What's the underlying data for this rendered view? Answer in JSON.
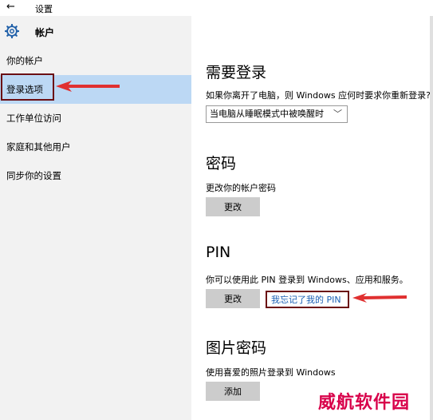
{
  "titlebar": {
    "back_glyph": "←",
    "title": "设置"
  },
  "sidebar": {
    "section_title": "帐户",
    "section_icon": "gear-icon",
    "items": [
      {
        "label": "你的帐户"
      },
      {
        "label": "登录选项",
        "selected": true
      },
      {
        "label": "工作单位访问"
      },
      {
        "label": "家庭和其他用户"
      },
      {
        "label": "同步你的设置"
      }
    ]
  },
  "require_signin": {
    "heading": "需要登录",
    "description": "如果你离开了电脑，则 Windows 应何时要求你重新登录?",
    "dropdown_value": "当电脑从睡眠模式中被唤醒时",
    "dropdown_chevron": "﹀"
  },
  "password": {
    "heading": "密码",
    "description": "更改你的帐户密码",
    "change_label": "更改"
  },
  "pin": {
    "heading": "PIN",
    "description": "你可以使用此 PIN 登录到 Windows、应用和服务。",
    "change_label": "更改",
    "forgot_link": "我忘记了我的 PIN"
  },
  "picture_password": {
    "heading": "图片密码",
    "description": "使用喜爱的照片登录到 Windows",
    "add_label": "添加"
  },
  "watermark": "威航软件园",
  "colors": {
    "selected_bg": "#bcd8f4",
    "link": "#1a5fb4",
    "annotation": "#e03030",
    "box": "#6b0f14"
  }
}
